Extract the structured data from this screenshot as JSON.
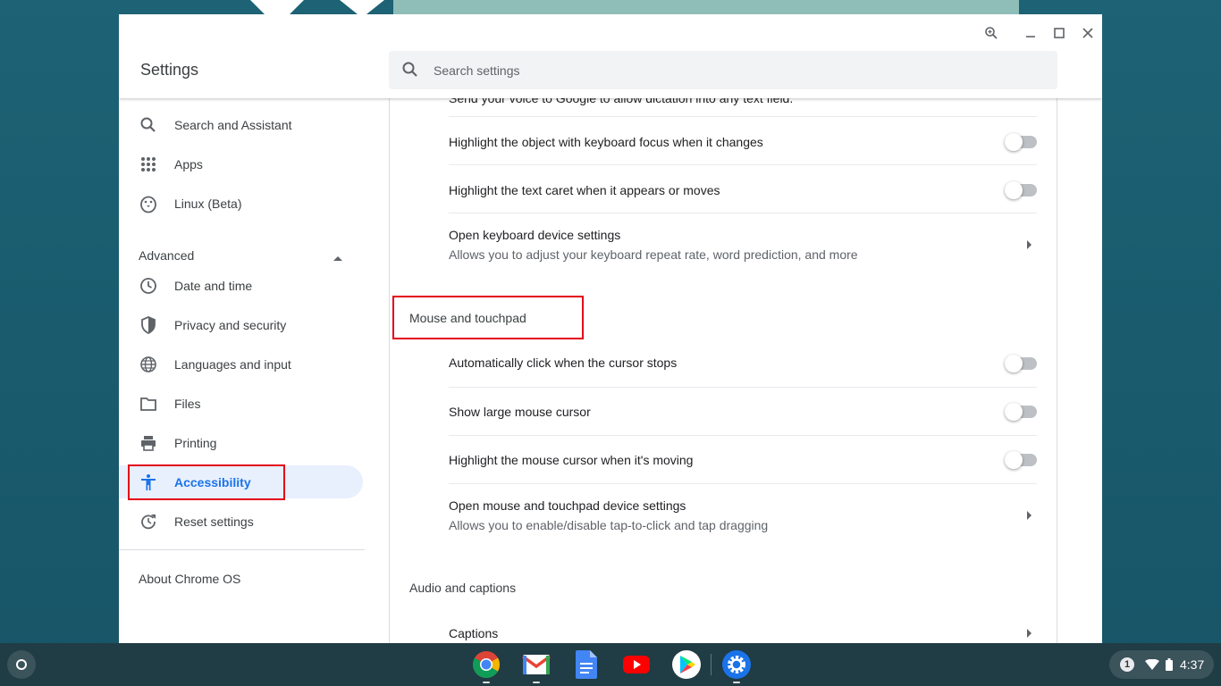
{
  "window": {
    "title": "Settings",
    "search_placeholder": "Search settings"
  },
  "sidebar": {
    "items": [
      {
        "label": "Search and Assistant",
        "icon": "search-icon"
      },
      {
        "label": "Apps",
        "icon": "apps-grid-icon"
      },
      {
        "label": "Linux (Beta)",
        "icon": "linux-penguin-icon"
      }
    ],
    "advanced_label": "Advanced",
    "advanced_items": [
      {
        "label": "Date and time",
        "icon": "clock-icon"
      },
      {
        "label": "Privacy and security",
        "icon": "shield-icon"
      },
      {
        "label": "Languages and input",
        "icon": "globe-icon"
      },
      {
        "label": "Files",
        "icon": "folder-icon"
      },
      {
        "label": "Printing",
        "icon": "printer-icon"
      },
      {
        "label": "Accessibility",
        "icon": "accessibility-icon",
        "active": true
      },
      {
        "label": "Reset settings",
        "icon": "reset-icon"
      }
    ],
    "about_label": "About Chrome OS"
  },
  "content": {
    "clipped_text": "Send your voice to Google to allow dictation into any text field.",
    "keyboard_rows": [
      {
        "label": "Highlight the object with keyboard focus when it changes",
        "enabled": false
      },
      {
        "label": "Highlight the text caret when it appears or moves",
        "enabled": false
      }
    ],
    "keyboard_link": {
      "label": "Open keyboard device settings",
      "sub": "Allows you to adjust your keyboard repeat rate, word prediction, and more"
    },
    "mouse_section_title": "Mouse and touchpad",
    "mouse_rows": [
      {
        "label": "Automatically click when the cursor stops",
        "enabled": false
      },
      {
        "label": "Show large mouse cursor",
        "enabled": false
      },
      {
        "label": "Highlight the mouse cursor when it's moving",
        "enabled": false
      }
    ],
    "mouse_link": {
      "label": "Open mouse and touchpad device settings",
      "sub": "Allows you to enable/disable tap-to-click and tap dragging"
    },
    "audio_section_title": "Audio and captions",
    "captions_label": "Captions"
  },
  "shelf": {
    "apps": [
      "chrome-icon",
      "gmail-icon",
      "docs-icon",
      "youtube-icon",
      "play-store-icon",
      "settings-icon"
    ],
    "notification_count": "1",
    "time": "4:37"
  },
  "colors": {
    "accent": "#1a73e8",
    "active_bg": "#e8f0fe",
    "highlight_box": "#e3001b"
  }
}
